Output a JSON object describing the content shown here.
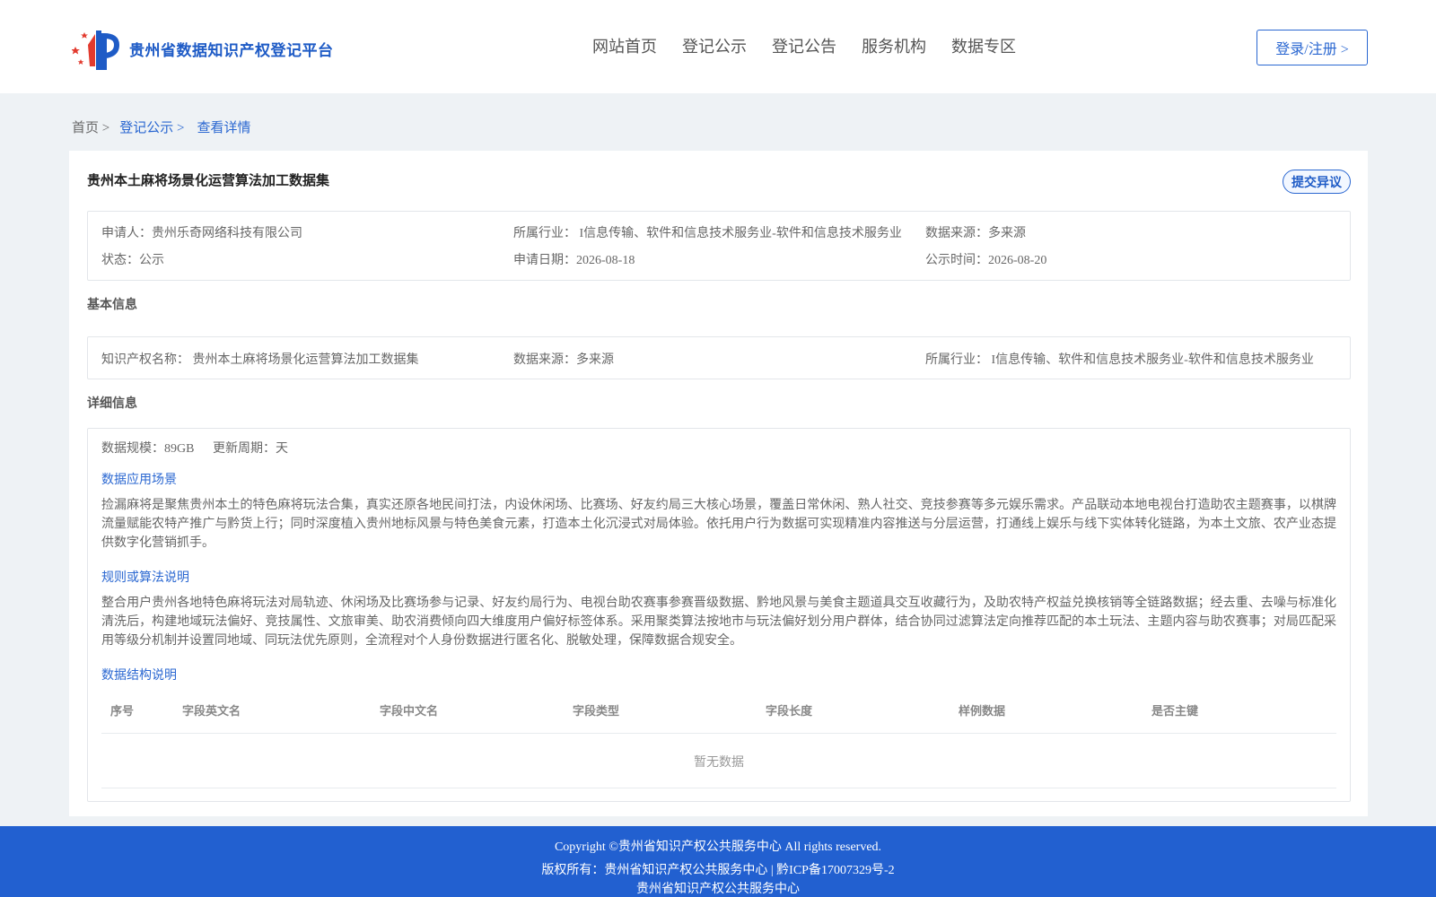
{
  "header": {
    "site_title": "贵州省数据知识产权登记平台",
    "nav": [
      "网站首页",
      "登记公示",
      "登记公告",
      "服务机构",
      "数据专区"
    ],
    "login_label": "登录/注册 >"
  },
  "breadcrumb": {
    "home": "首页 >",
    "section": "登记公示 >",
    "current": "查看详情"
  },
  "record": {
    "title": "贵州本土麻将场景化运营算法加工数据集",
    "objection_label": "提交异议",
    "applicant": "申请人：贵州乐奇网络科技有限公司",
    "industry": "所属行业： I信息传输、软件和信息技术服务业-软件和信息技术服务业",
    "source": "数据来源：多来源",
    "status": "状态：公示",
    "apply_date": "申请日期：2026-08-18",
    "publish_date": "公示时间：2026-08-20"
  },
  "basic": {
    "section_title": "基本信息",
    "ip_name": "知识产权名称： 贵州本土麻将场景化运营算法加工数据集",
    "source": "数据来源：多来源",
    "industry": "所属行业： I信息传输、软件和信息技术服务业-软件和信息技术服务业"
  },
  "detail": {
    "section_title": "详细信息",
    "scale": "数据规模：89GB",
    "update_cycle": "更新周期：天",
    "scenario_title": "数据应用场景",
    "scenario_text": "捡漏麻将是聚焦贵州本土的特色麻将玩法合集，真实还原各地民间打法，内设休闲场、比赛场、好友约局三大核心场景，覆盖日常休闲、熟人社交、竞技参赛等多元娱乐需求。产品联动本地电视台打造助农主题赛事，以棋牌流量赋能农特产推广与黔货上行；同时深度植入贵州地标风景与特色美食元素，打造本土化沉浸式对局体验。依托用户行为数据可实现精准内容推送与分层运营，打通线上娱乐与线下实体转化链路，为本土文旅、农产业态提供数字化营销抓手。",
    "rules_title": "规则或算法说明",
    "rules_text": "整合用户贵州各地特色麻将玩法对局轨迹、休闲场及比赛场参与记录、好友约局行为、电视台助农赛事参赛晋级数据、黔地风景与美食主题道具交互收藏行为，及助农特产权益兑换核销等全链路数据；经去重、去噪与标准化清洗后，构建地域玩法偏好、竞技属性、文旅审美、助农消费倾向四大维度用户偏好标签体系。采用聚类算法按地市与玩法偏好划分用户群体，结合协同过滤算法定向推荐匹配的本土玩法、主题内容与助农赛事；对局匹配采用等级分机制并设置同地域、同玩法优先原则，全流程对个人身份数据进行匿名化、脱敏处理，保障数据合规安全。",
    "structure_title": "数据结构说明",
    "table_headers": [
      "序号",
      "字段英文名",
      "字段中文名",
      "字段类型",
      "字段长度",
      "样例数据",
      "是否主键"
    ],
    "empty_text": "暂无数据"
  },
  "footer": {
    "copyright": "Copyright ©贵州省知识产权公共服务中心 All rights reserved.",
    "rights": "版权所有：贵州省知识产权公共服务中心 | 黔ICP备17007329号-2",
    "org": "贵州省知识产权公共服务中心"
  }
}
